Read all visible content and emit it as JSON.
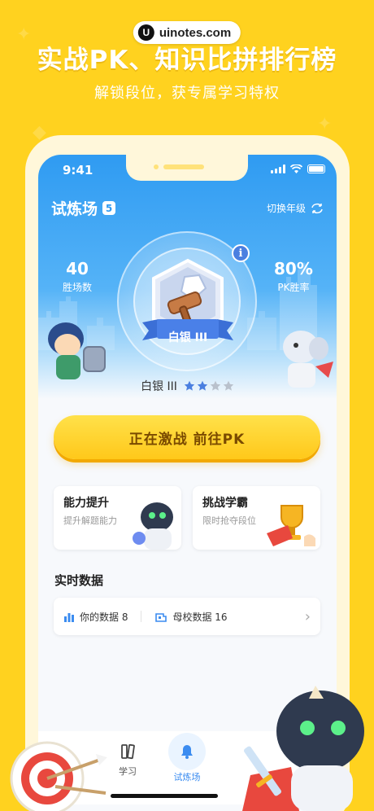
{
  "watermark": {
    "icon": "u-logo-icon",
    "text": "uinotes.com"
  },
  "promo": {
    "headline": "实战PK、知识比拼排行榜",
    "subline": "解锁段位，获专属学习特权"
  },
  "status_bar": {
    "time": "9:41"
  },
  "header": {
    "title": "试炼场",
    "level_badge": "5",
    "switch_grade_label": "切换年级"
  },
  "stats": {
    "wins_value": "40",
    "wins_label": "胜场数",
    "pk_rate_value": "80%",
    "pk_rate_label": "PK胜率"
  },
  "rank": {
    "ribbon_text": "白银 III",
    "name": "白银 III",
    "stars_filled": 2,
    "stars_total": 4,
    "emblem_icon": "silver-hammer-emblem-icon"
  },
  "cta": {
    "label": "正在激战 前往PK"
  },
  "cards": [
    {
      "title": "能力提升",
      "subtitle": "提升解题能力",
      "icon": "robot-mascot-icon"
    },
    {
      "title": "挑战学霸",
      "subtitle": "限时抢夺段位",
      "icon": "trophy-icon"
    }
  ],
  "realtime": {
    "section_title": "实时数据",
    "my_data": "你的数据 8",
    "school_data": "母校数据 16"
  },
  "tabbar": {
    "tabs": [
      {
        "label": "学习",
        "icon": "book-icon",
        "active": false
      },
      {
        "label": "试炼场",
        "icon": "bell-icon",
        "active": true
      }
    ]
  },
  "colors": {
    "background": "#FFD21F",
    "hero_blue": "#2F9BF2",
    "cta_yellow": "#FFC81A",
    "star_blue": "#4A7FE0",
    "star_gray": "#B9C1CC"
  }
}
